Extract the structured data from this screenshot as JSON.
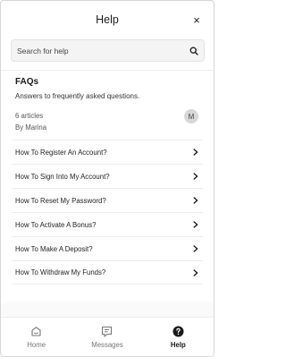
{
  "header": {
    "title": "Help",
    "close_glyph": "×"
  },
  "search": {
    "placeholder": "Search for help",
    "value": ""
  },
  "faq": {
    "title": "FAQs",
    "description": "Answers to frequently asked questions.",
    "articles_count": "6 articles",
    "author": "By Marina",
    "avatar_initial": "M"
  },
  "articles": [
    {
      "label": "How To Register An Account?"
    },
    {
      "label": "How To Sign Into My Account?"
    },
    {
      "label": "How To Reset My Password?"
    },
    {
      "label": "How To Activate A Bonus?"
    },
    {
      "label": "How To Make A Deposit?"
    },
    {
      "label": "How To Withdraw My Funds?"
    }
  ],
  "nav": {
    "items": [
      {
        "label": "Home",
        "icon": "home-icon",
        "active": false
      },
      {
        "label": "Messages",
        "icon": "messages-icon",
        "active": false
      },
      {
        "label": "Help",
        "icon": "help-icon",
        "active": true
      }
    ]
  },
  "colors": {
    "text": "#1a1a1a",
    "muted": "#777777",
    "border": "#ececec"
  }
}
